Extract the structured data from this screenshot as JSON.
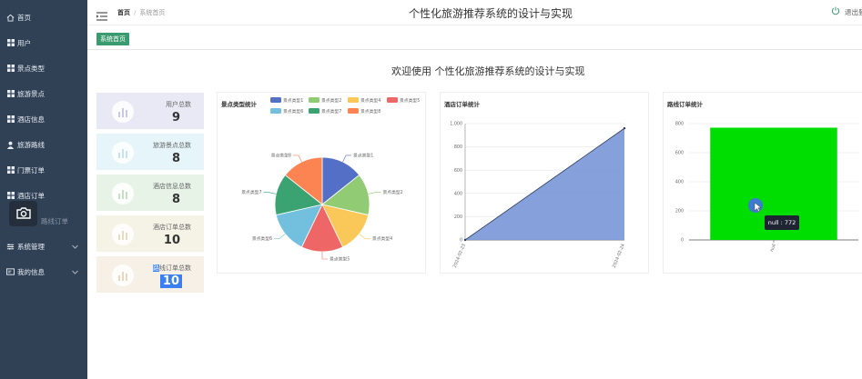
{
  "sidebar": {
    "items": [
      {
        "label": "首页",
        "icon": "home-icon"
      },
      {
        "label": "用户",
        "icon": "grid-icon"
      },
      {
        "label": "景点类型",
        "icon": "grid-icon"
      },
      {
        "label": "旅游景点",
        "icon": "grid-icon"
      },
      {
        "label": "酒店信息",
        "icon": "grid-icon"
      },
      {
        "label": "旅游路线",
        "icon": "person-icon"
      },
      {
        "label": "门票订单",
        "icon": "grid-icon"
      },
      {
        "label": "酒店订单",
        "icon": "grid-icon"
      },
      {
        "label": "路线订单",
        "icon": "grid-icon"
      },
      {
        "label": "系统管理",
        "icon": "sliders-icon"
      },
      {
        "label": "我的信息",
        "icon": "id-card-icon"
      }
    ]
  },
  "header": {
    "breadcrumb_home": "首页",
    "breadcrumb_current": "系统首页",
    "title": "个性化旅游推荐系统的设计与实现",
    "logout": "退出登录"
  },
  "tagbar": {
    "active_tag": "系统首页"
  },
  "welcome": "欢迎使用 个性化旅游推荐系统的设计与实现",
  "stats": [
    {
      "label": "用户总数",
      "value": "9",
      "bg": "#e9e9f6"
    },
    {
      "label": "旅游景点总数",
      "value": "8",
      "bg": "#e5f5fa"
    },
    {
      "label": "酒店信息总数",
      "value": "8",
      "bg": "#e8f3e8"
    },
    {
      "label": "酒店订单总数",
      "value": "10",
      "bg": "#f5f2e6"
    },
    {
      "label_highlight": "路",
      "label_rest": "线订单总数",
      "value": "10",
      "bg": "#f7f0e6"
    }
  ],
  "charts": {
    "pie_title": "景点类型统计",
    "area_title": "酒店订单统计",
    "bar_title": "路线订单统计",
    "tooltip": "null : 772"
  },
  "colors": {
    "sidebar": "#304156",
    "accent": "#3b9b70",
    "bar": "#00dd00",
    "area": "#7e9bd8"
  },
  "chart_data": [
    {
      "type": "pie",
      "title": "景点类型统计",
      "categories": [
        "景点类型1",
        "景点类型2",
        "景点类型4",
        "景点类型5",
        "景点类型6",
        "景点类型7",
        "景点类型8"
      ],
      "values": [
        1,
        1,
        1,
        1,
        1,
        1,
        1
      ],
      "legend": [
        "景点类型1",
        "景点类型2",
        "景点类型4",
        "景点类型5",
        "景点类型6",
        "景点类型7",
        "景点类型8"
      ],
      "colors": [
        "#5470c6",
        "#91cc75",
        "#fac858",
        "#ee6666",
        "#73c0de",
        "#3ba272",
        "#fc8452"
      ],
      "legend_placement": "top"
    },
    {
      "type": "area",
      "title": "酒店订单统计",
      "x": [
        "2024-02-23",
        "2024-02-24"
      ],
      "values": [
        0,
        960
      ],
      "ylim": [
        0,
        1000
      ],
      "yticks": [
        "0",
        "200",
        "400",
        "600",
        "800",
        "1,000"
      ],
      "grid": true
    },
    {
      "type": "bar",
      "title": "路线订单统计",
      "categories": [
        "null"
      ],
      "values": [
        772
      ],
      "ylim": [
        0,
        800
      ],
      "yticks": [
        "0",
        "200",
        "400",
        "600",
        "800"
      ],
      "grid": true
    }
  ]
}
